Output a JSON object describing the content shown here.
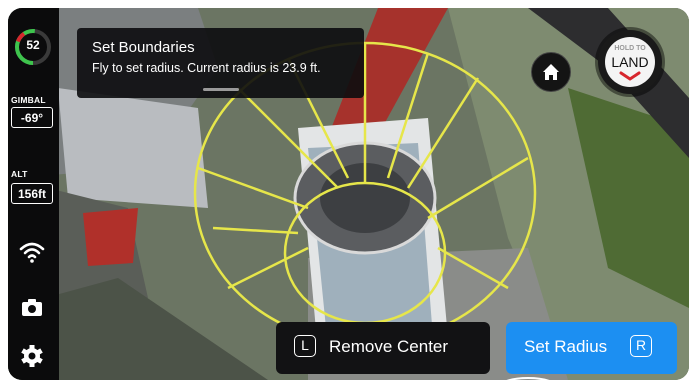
{
  "sidebar": {
    "battery_percent": "52",
    "gimbal_label": "GIMBAL",
    "gimbal_value": "-69°",
    "alt_label": "ALT",
    "alt_value": "156ft",
    "icons": [
      "wifi-icon",
      "camera-icon",
      "gear-icon"
    ]
  },
  "toast": {
    "title": "Set Boundaries",
    "body": "Fly to set radius. Current radius is 23.9 ft."
  },
  "land_button": {
    "hold_text": "HOLD TO",
    "action": "LAND"
  },
  "actions": {
    "remove_key": "L",
    "remove_label": "Remove Center",
    "set_key": "R",
    "set_label": "Set Radius"
  },
  "colors": {
    "boundary": "#e6e64a",
    "primary": "#1c8ff2",
    "battery_ring": "#3ec44d",
    "land_accent": "#d7262d"
  }
}
